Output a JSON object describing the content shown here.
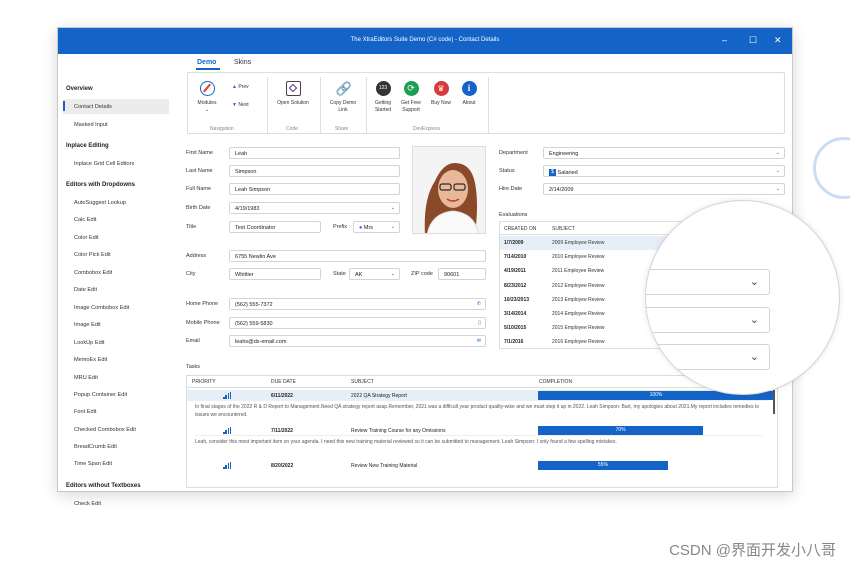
{
  "window": {
    "title": "The XtraEditors Suite Demo (C# code) - Contact Details",
    "minimize": "–",
    "maximize": "☐",
    "close": "✕"
  },
  "sidebar": {
    "groups": [
      "Overview",
      "Inplace Editing",
      "Editors with Dropdowns",
      "Editors without Textboxes"
    ],
    "items": [
      "Contact Details",
      "Masked Input",
      "Inplace Grid Cell Editors",
      "AutoSuggest Lookup",
      "Calc Edit",
      "Color Edit",
      "Color Pick Edit",
      "Combobox Edit",
      "Date Edit",
      "Image Combobox Edit",
      "Image Edit",
      "LookUp Edit",
      "MemoEx Edit",
      "MRU Edit",
      "Popup Container Edit",
      "Font Edit",
      "Checked Combobox Edit",
      "BreadCrumb Edit",
      "Time Span Edit",
      "Check Edit"
    ]
  },
  "tabs": [
    "Demo",
    "Skins"
  ],
  "ribbon": {
    "modules": "Modules",
    "prev": "Prev",
    "next": "Next",
    "navigation": "Navigation",
    "open_solution": "Open Solution",
    "code": "Code",
    "copy_demo_link_1": "Copy Demo",
    "copy_demo_link_2": "Link",
    "share": "Share",
    "getting_started_1": "Getting",
    "getting_started_2": "Started",
    "free_support_1": "Get Free",
    "free_support_2": "Support",
    "buy_now": "Buy Now",
    "about": "About",
    "devexpress": "DevExpress",
    "icon_123": "123"
  },
  "form": {
    "first_name_label": "First Name",
    "first_name": "Leah",
    "last_name_label": "Last Name",
    "last_name": "Simpson",
    "full_name_label": "Full Name",
    "full_name": "Leah Simpson",
    "birth_date_label": "Birth Date",
    "birth_date": "4/19/1983",
    "title_label": "Title",
    "title": "Test Coordinator",
    "prefix_label": "Prefix",
    "prefix": "Mrs",
    "address_label": "Address",
    "address": "6755 Newlin Ave",
    "city_label": "City",
    "city": "Whittier",
    "state_label": "State",
    "state": "AK",
    "zip_label": "ZIP code",
    "zip": "90601",
    "home_phone_label": "Home Phone",
    "home_phone": "(562) 555-7372",
    "mobile_phone_label": "Mobile Phone",
    "mobile_phone": "(562) 559-5830",
    "email_label": "Email",
    "email": "leahs@dx-email.com",
    "department_label": "Department",
    "department": "Engineering",
    "status_label": "Status",
    "status": "Salaried",
    "hire_date_label": "Hire Date",
    "hire_date": "2/14/2009",
    "evaluations_label": "Evaluations"
  },
  "evaluations": {
    "columns": [
      "CREATED ON",
      "SUBJECT"
    ],
    "rows": [
      [
        "1/7/2009",
        "2009 Employee Review"
      ],
      [
        "7/14/2010",
        "2010 Employee Review"
      ],
      [
        "4/19/2011",
        "2011 Employee Review"
      ],
      [
        "8/23/2012",
        "2012 Employee Review"
      ],
      [
        "10/23/2013",
        "2013 Employee Review"
      ],
      [
        "3/14/2014",
        "2014 Employee Review"
      ],
      [
        "5/10/2015",
        "2015 Employee Review"
      ],
      [
        "7/1/2016",
        "2016 Employee Review"
      ]
    ]
  },
  "tasks": {
    "label": "Tasks",
    "columns": [
      "PRIORITY",
      "DUE DATE",
      "SUBJECT",
      "COMPLETION"
    ],
    "rows": [
      {
        "due": "6/11/2022",
        "subject": "2022 QA Strategy Report",
        "completion": 100,
        "completion_label": "100%",
        "note": "In final stages of the 2022 R & D Report to Management.Need QA strategy report asap.Remember, 2021 was a difficult year product quality-wise and we must step it up in 2022. Leah Simpson: Bart, my apologies about 2021.My report includes remedies to issues we encountered."
      },
      {
        "due": "7/11/2022",
        "subject": "Review Training Course for any Omissions",
        "completion": 70,
        "completion_label": "70%",
        "note": "Leah, consider this most important item on your agenda. I need this new training material reviewed so it can be submitted to management. Leah Simpson: I only found a few spelling mistakes."
      },
      {
        "due": "8/20/2022",
        "subject": "Review New Training Material",
        "completion": 55,
        "completion_label": "55%",
        "note": ""
      }
    ]
  },
  "watermark": "CSDN @界面开发小八哥"
}
